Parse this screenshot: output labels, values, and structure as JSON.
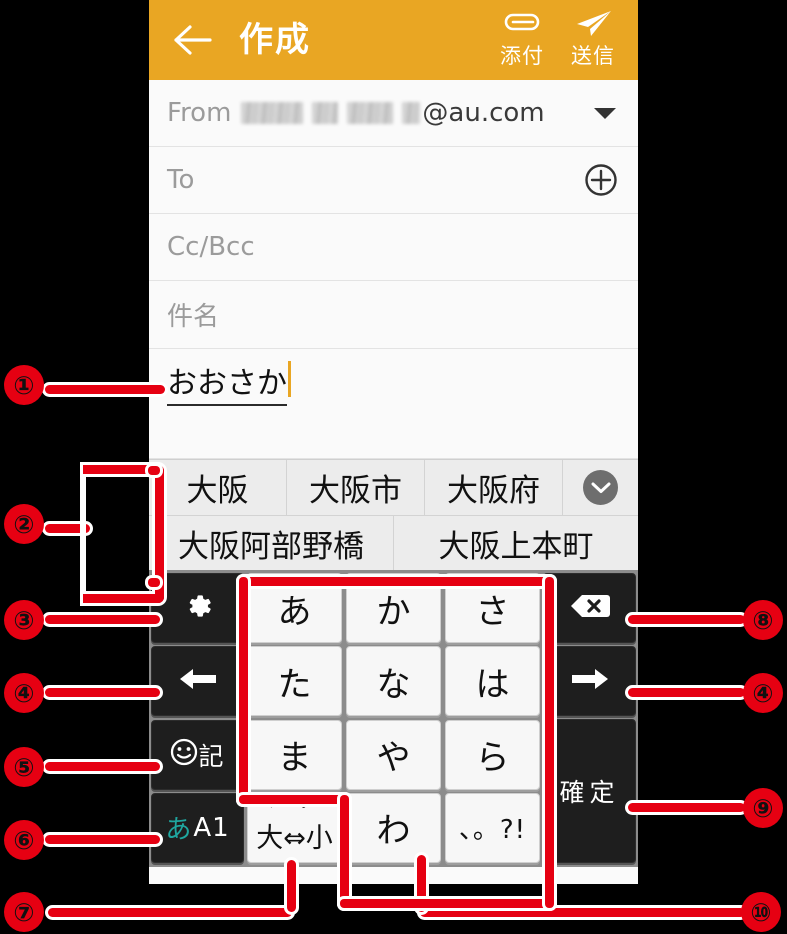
{
  "header": {
    "back_icon": "back-arrow-icon",
    "title": "作成",
    "attach": {
      "icon": "paperclip-icon",
      "label": "添付"
    },
    "send": {
      "icon": "paper-plane-icon",
      "label": "送信"
    },
    "bg_color": "#e9a623"
  },
  "form": {
    "from": {
      "label": "From",
      "value_suffix": "@au.com",
      "value_masked": true,
      "dropdown_icon": "caret-down-icon"
    },
    "to": {
      "placeholder": "To",
      "add_icon": "plus-circle-icon"
    },
    "ccbcc": {
      "placeholder": "Cc/Bcc"
    },
    "subject": {
      "placeholder": "件名"
    }
  },
  "body": {
    "composing_text": "おおさか",
    "caret_color": "#e9a623"
  },
  "candidates": {
    "row1": [
      "大阪",
      "大阪市",
      "大阪府"
    ],
    "expand_icon": "chevron-down-circle-icon",
    "row2": [
      "大阪阿部野橋",
      "大阪上本町"
    ]
  },
  "keyboard": {
    "left_column": [
      {
        "name": "settings-key",
        "icon": "gear-icon",
        "label": ""
      },
      {
        "name": "cursor-left-key",
        "icon": "arrow-left-icon",
        "label": ""
      },
      {
        "name": "emoji-symbol-key",
        "icon": "smiley-icon",
        "label": "記"
      },
      {
        "name": "input-mode-key",
        "label_ja": "あ",
        "label_en": "A1"
      }
    ],
    "center_keys": [
      [
        "あ",
        "か",
        "さ"
      ],
      [
        "た",
        "な",
        "は"
      ],
      [
        "ま",
        "や",
        "ら"
      ]
    ],
    "center_bottom": {
      "daku_key": {
        "top": "゛゜",
        "bottom": "大⇔小"
      },
      "wa_key": "わ",
      "punct_key": "、。?!"
    },
    "right_column": [
      {
        "name": "backspace-key",
        "icon": "backspace-icon",
        "label": ""
      },
      {
        "name": "cursor-right-key",
        "icon": "arrow-right-icon",
        "label": ""
      },
      {
        "name": "confirm-key",
        "label": "確定"
      }
    ]
  },
  "callouts": [
    {
      "id": "1",
      "number": "①"
    },
    {
      "id": "2",
      "number": "②"
    },
    {
      "id": "3",
      "number": "③"
    },
    {
      "id": "4a",
      "number": "④"
    },
    {
      "id": "4b",
      "number": "④"
    },
    {
      "id": "5",
      "number": "⑤"
    },
    {
      "id": "6",
      "number": "⑥"
    },
    {
      "id": "7",
      "number": "⑦"
    },
    {
      "id": "8",
      "number": "⑧"
    },
    {
      "id": "9",
      "number": "⑨"
    },
    {
      "id": "10",
      "number": "⑩"
    }
  ],
  "colors": {
    "accent_orange": "#e9a623",
    "callout_red": "#e60012",
    "key_dark": "#1e1e1e",
    "key_light": "#f7f7f7",
    "mode_teal": "#1fa7a0"
  }
}
